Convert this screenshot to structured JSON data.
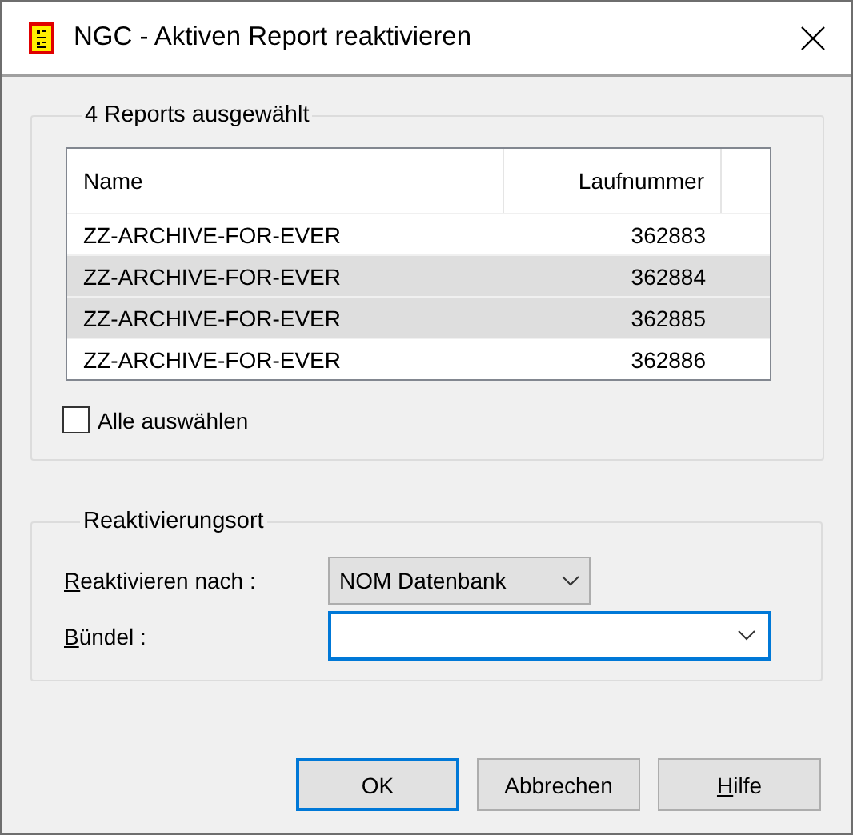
{
  "window": {
    "title": "NGC - Aktiven Report reaktivieren"
  },
  "reports_group": {
    "title": "4 Reports ausgewählt",
    "table": {
      "columns": [
        "Name",
        "Laufnummer"
      ],
      "rows": [
        {
          "name": "ZZ-ARCHIVE-FOR-EVER",
          "number": "362883",
          "selected": false
        },
        {
          "name": "ZZ-ARCHIVE-FOR-EVER",
          "number": "362884",
          "selected": true
        },
        {
          "name": "ZZ-ARCHIVE-FOR-EVER",
          "number": "362885",
          "selected": true
        },
        {
          "name": "ZZ-ARCHIVE-FOR-EVER",
          "number": "362886",
          "selected": false
        }
      ]
    },
    "select_all": {
      "label": "Alle auswählen",
      "checked": false
    }
  },
  "location_group": {
    "title": "Reaktivierungsort",
    "target": {
      "label": "Reaktivieren nach :",
      "access_key": true,
      "value": "NOM Datenbank"
    },
    "bundle": {
      "label": "Bündel :",
      "access_key": true,
      "focused": true
    }
  },
  "buttons": [
    {
      "label": "OK",
      "default": true,
      "access_key": false
    },
    {
      "label": "Abbrechen",
      "default": false,
      "access_key": false
    },
    {
      "label": "Hilfe",
      "default": false,
      "access_key": true
    }
  ]
}
